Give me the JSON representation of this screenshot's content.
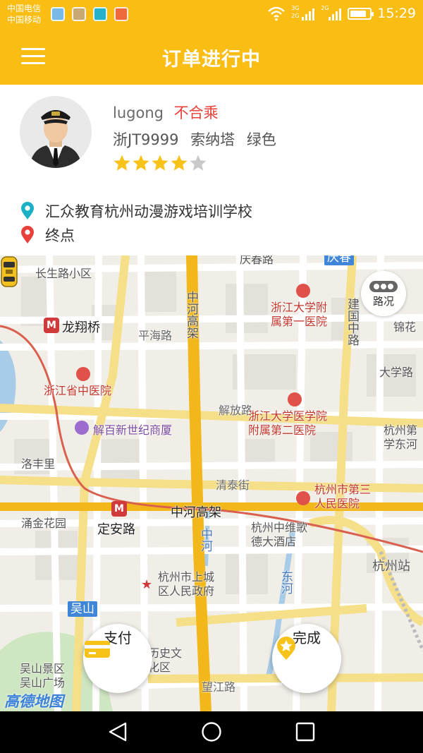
{
  "status_bar": {
    "carrier_1": "中国电信",
    "carrier_2": "中国移动",
    "network_1": "3G",
    "network_2": "2G",
    "network_3": "2G",
    "time": "15:29",
    "battery_level": 0.85,
    "app_icons": [
      "weather-app-icon",
      "gallery-app-icon",
      "calendar-app-icon",
      "browser-app-icon"
    ]
  },
  "header": {
    "title": "订单进行中",
    "menu_icon": "hamburger-menu-icon"
  },
  "driver": {
    "name": "lugong",
    "status": "不合乘",
    "plate": "浙JT9999",
    "car_model": "索纳塔",
    "car_color": "绿色",
    "rating": 4,
    "rating_max": 5
  },
  "route": {
    "from": "汇众教育杭州动漫游戏培训学校",
    "to": "终点"
  },
  "map": {
    "traffic_button": "路况",
    "labels": {
      "changsheng": "长生路小区",
      "longxiang": "龙翔桥",
      "pinghai": "平海路",
      "zjzyy": "浙江省中医院",
      "jiebai": "解百新世纪商厦",
      "luofeng": "洛丰里",
      "yongjin": "涌金花园",
      "dinganlu": "定安路",
      "shangcheng_gov": "杭州市上城\n区人民政府",
      "wushan": "吴山",
      "wushan_scenic": "吴山景区\n吴山广场",
      "lishi": "历史文\n化区",
      "wangjiang": "望江路",
      "zhonghe_gaojia_v": "中河高架",
      "zhonghe_gaojia_h": "中河高架",
      "zhonghe_river": "中河",
      "qingtai": "清泰街",
      "zju1": "浙江大学附\n属第一医院",
      "zju2": "浙江大学医学院\n附属第二医院",
      "hz3": "杭州市第三\n人民医院",
      "jianguo": "建国中路",
      "daxuelu": "大学路",
      "jinhua": "锦花",
      "hzdisi": "杭州第\n学东河",
      "zhongwei": "杭州中维歌\n德大酒店",
      "donghe": "东河",
      "hzstation": "杭州站",
      "qingchun": "庆春路",
      "jiefang": "解放路",
      "qingchun_tag": "庆春"
    },
    "logo": "高德地图",
    "pay_button": "支付",
    "done_button": "完成"
  },
  "nav_bar": {
    "back": "back-triangle-icon",
    "home": "home-circle-icon",
    "recents": "recents-square-icon"
  },
  "colors": {
    "brand": "#f9bd14",
    "status_red": "#e8403a",
    "star": "#f7c21a",
    "start_pin": "#1ab1c6",
    "end_pin": "#e8403a"
  }
}
